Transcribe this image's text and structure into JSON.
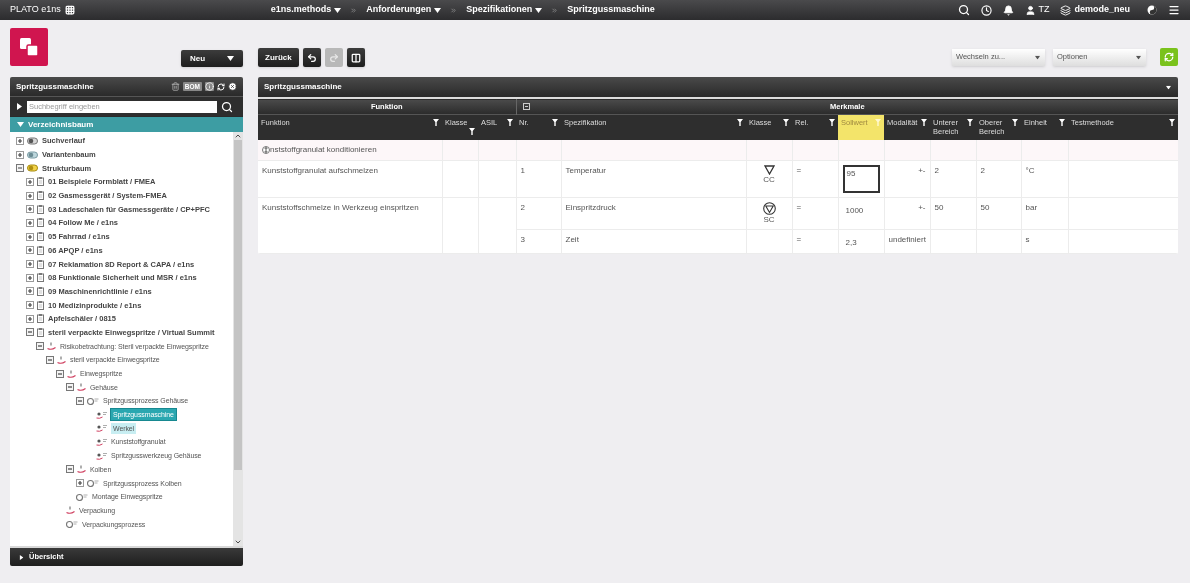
{
  "topbar": {
    "app_title": "PLATO e1ns",
    "breadcrumbs": [
      {
        "label": "e1ns.methods",
        "dropdown": true
      },
      {
        "label": "Anforderungen",
        "dropdown": true
      },
      {
        "label": "Spezifikationen",
        "dropdown": true
      },
      {
        "label": "Spritzgussmaschine",
        "dropdown": false
      }
    ],
    "user": "TZ",
    "database": "demode_neu"
  },
  "toolbar": {
    "new_button": "Neu",
    "back_button": "Zurück",
    "redo_disabled": true,
    "switch_select": "Wechseln zu...",
    "options_select": "Optionen"
  },
  "tree_panel": {
    "title": "Spritzgussmaschine",
    "bom_label": "BOM",
    "search_placeholder": "Suchbegriff eingeben",
    "section": "Verzeichnisbaum",
    "footer": "Übersicht",
    "nodes": [
      {
        "label": "Suchverlauf",
        "kind": "history",
        "expanded": false,
        "selected": false,
        "hovered": false
      },
      {
        "label": "Variantenbaum",
        "kind": "variant",
        "expanded": false,
        "selected": false,
        "hovered": false
      },
      {
        "label": "Strukturbaum",
        "kind": "structure",
        "expanded": true,
        "selected": false,
        "hovered": false,
        "children": [
          {
            "label": "01 Beispiele Formblatt / FMEA",
            "kind": "document",
            "expanded": false,
            "selected": false,
            "hovered": false
          },
          {
            "label": "02 Gasmessgerät / System-FMEA",
            "kind": "document",
            "expanded": false,
            "selected": false,
            "hovered": false
          },
          {
            "label": "03 Ladeschalen für Gasmessgeräte / CP+PFC",
            "kind": "document",
            "expanded": false,
            "selected": false,
            "hovered": false
          },
          {
            "label": "04 Follow Me / e1ns",
            "kind": "document",
            "expanded": false,
            "selected": false,
            "hovered": false
          },
          {
            "label": "05 Fahrrad / e1ns",
            "kind": "document",
            "expanded": false,
            "selected": false,
            "hovered": false
          },
          {
            "label": "06 APQP / e1ns",
            "kind": "document",
            "expanded": false,
            "selected": false,
            "hovered": false
          },
          {
            "label": "07 Reklamation 8D Report & CAPA / e1ns",
            "kind": "document",
            "expanded": false,
            "selected": false,
            "hovered": false
          },
          {
            "label": "08 Funktionale Sicherheit und MSR / e1ns",
            "kind": "document",
            "expanded": false,
            "selected": false,
            "hovered": false
          },
          {
            "label": "09 Maschinenrichtlinie / e1ns",
            "kind": "document",
            "expanded": false,
            "selected": false,
            "hovered": false
          },
          {
            "label": "10 Medizinprodukte / e1ns",
            "kind": "document",
            "expanded": false,
            "selected": false,
            "hovered": false
          },
          {
            "label": "Apfelschäler / 0815",
            "kind": "document",
            "expanded": false,
            "selected": false,
            "hovered": false
          },
          {
            "label": "steril verpackte Einwegspritze / Virtual Summit",
            "kind": "document",
            "expanded": true,
            "selected": false,
            "hovered": false,
            "children": [
              {
                "label": "Risikobetrachtung: Steril verpackte Einwegspritze",
                "kind": "risk",
                "expanded": true,
                "selected": false,
                "hovered": false,
                "children": [
                  {
                    "label": "steril verpackte Einwegspritze",
                    "kind": "risk",
                    "expanded": true,
                    "selected": false,
                    "hovered": false,
                    "children": [
                      {
                        "label": "Einwegspritze",
                        "kind": "risk",
                        "expanded": true,
                        "selected": false,
                        "hovered": false,
                        "children": [
                          {
                            "label": "Gehäuse",
                            "kind": "risk",
                            "expanded": true,
                            "selected": false,
                            "hovered": false,
                            "children": [
                              {
                                "label": "Spritzgussprozess Gehäuse",
                                "kind": "process",
                                "expanded": true,
                                "selected": false,
                                "hovered": false,
                                "children": [
                                  {
                                    "label": "Spritzgussmaschine",
                                    "kind": "element",
                                    "selected": true,
                                    "hovered": false
                                  },
                                  {
                                    "label": "Werkel",
                                    "kind": "element",
                                    "selected": false,
                                    "hovered": true
                                  },
                                  {
                                    "label": "Kunststoffgranulat",
                                    "kind": "element",
                                    "selected": false,
                                    "hovered": false
                                  },
                                  {
                                    "label": "Spritzgusswerkzeug Gehäuse",
                                    "kind": "element",
                                    "selected": false,
                                    "hovered": false
                                  }
                                ]
                              }
                            ]
                          },
                          {
                            "label": "Kolben",
                            "kind": "risk",
                            "expanded": true,
                            "selected": false,
                            "hovered": false,
                            "children": [
                              {
                                "label": "Spritzgussprozess Kolben",
                                "kind": "process",
                                "expanded": false,
                                "selected": false,
                                "hovered": false
                              },
                              {
                                "label": "Montage Einwegspritze",
                                "kind": "process",
                                "selected": false,
                                "hovered": false
                              }
                            ]
                          },
                          {
                            "label": "Verpackung",
                            "kind": "risk",
                            "selected": false,
                            "hovered": false
                          },
                          {
                            "label": "Verpackungsprozess",
                            "kind": "process",
                            "selected": false,
                            "hovered": false
                          }
                        ]
                      }
                    ]
                  }
                ]
              }
            ]
          }
        ]
      }
    ]
  },
  "main_panel": {
    "title": "Spritzgussmaschine",
    "groups": [
      "Funktion",
      "Merkmale"
    ],
    "columns": [
      {
        "label": "Funktion",
        "filter": true,
        "highlighted": false
      },
      {
        "label": "Klasse",
        "filter": true,
        "highlighted": false
      },
      {
        "label": "ASIL",
        "filter": true,
        "highlighted": false
      },
      {
        "label": "Nr.",
        "filter": true,
        "highlighted": false
      },
      {
        "label": "Spezifikation",
        "filter": true,
        "highlighted": false
      },
      {
        "label": "Klasse",
        "filter": true,
        "highlighted": false
      },
      {
        "label": "Rel.",
        "filter": true,
        "highlighted": false
      },
      {
        "label": "Sollwert",
        "filter": true,
        "highlighted": true
      },
      {
        "label": "Modalität",
        "filter": true,
        "highlighted": false
      },
      {
        "label": "Unterer Bereich",
        "filter": true,
        "highlighted": false
      },
      {
        "label": "Oberer Bereich",
        "filter": true,
        "highlighted": false
      },
      {
        "label": "Einheit",
        "filter": true,
        "highlighted": false
      },
      {
        "label": "Testmethode",
        "filter": true,
        "highlighted": false
      }
    ],
    "rows": [
      {
        "function": "nststoffgranulat konditionieren",
        "reorder_handle": true,
        "merkmale": []
      },
      {
        "function": "Kunststoffgranulat aufschmelzen",
        "reorder_handle": false,
        "merkmale": [
          {
            "nr": "1",
            "spec": "Temperatur",
            "klasse": {
              "kind": "cc",
              "label": "CC"
            },
            "rel": "=",
            "sollwert": "95",
            "editing": true,
            "modalitaet": "+-",
            "unterer": "2",
            "oberer": "2",
            "einheit": "°C"
          }
        ]
      },
      {
        "function": "Kunststoffschmelze in Werkzeug einspritzen",
        "reorder_handle": false,
        "merkmale": [
          {
            "nr": "2",
            "spec": "Einspritzdruck",
            "klasse": {
              "kind": "sc",
              "label": "SC"
            },
            "rel": "=",
            "sollwert": "1000",
            "editing": false,
            "modalitaet": "+-",
            "unterer": "50",
            "oberer": "50",
            "einheit": "bar"
          },
          {
            "nr": "3",
            "spec": "Zeit",
            "rel": "=",
            "sollwert": "2,3",
            "editing": false,
            "modalitaet": "undefiniert",
            "einheit": "s"
          }
        ]
      }
    ]
  }
}
